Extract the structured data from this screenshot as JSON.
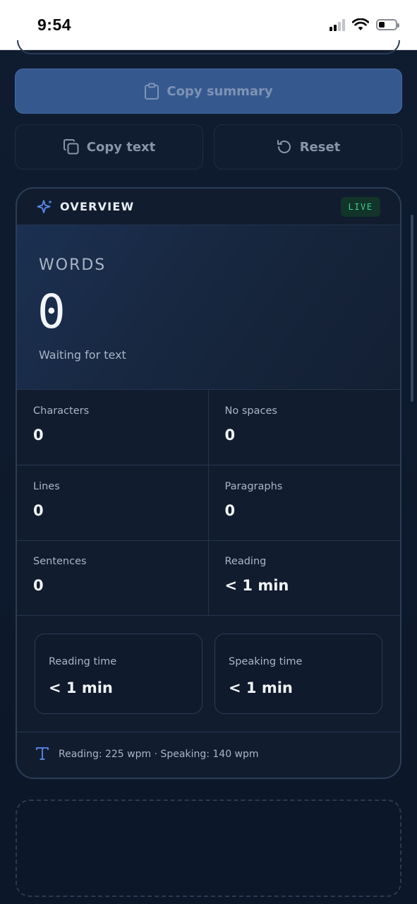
{
  "status_bar": {
    "time": "9:54"
  },
  "actions": {
    "copy_summary": "Copy summary",
    "copy_text": "Copy text",
    "reset": "Reset"
  },
  "overview": {
    "title": "OVERVIEW",
    "badge": "LIVE",
    "words_label": "WORDS",
    "words_value": "0",
    "words_sub": "Waiting for text",
    "stats": [
      {
        "label": "Characters",
        "value": "0"
      },
      {
        "label": "No spaces",
        "value": "0"
      },
      {
        "label": "Lines",
        "value": "0"
      },
      {
        "label": "Paragraphs",
        "value": "0"
      },
      {
        "label": "Sentences",
        "value": "0"
      },
      {
        "label": "Reading",
        "value": "< 1 min"
      }
    ],
    "reading_time": {
      "label": "Reading time",
      "value": "< 1 min"
    },
    "speaking_time": {
      "label": "Speaking time",
      "value": "< 1 min"
    },
    "rates": "Reading: 225 wpm · Speaking: 140 wpm"
  },
  "colors": {
    "accent": "#35598f",
    "live": "#3fcf8e",
    "background": "#0d1a2d"
  }
}
